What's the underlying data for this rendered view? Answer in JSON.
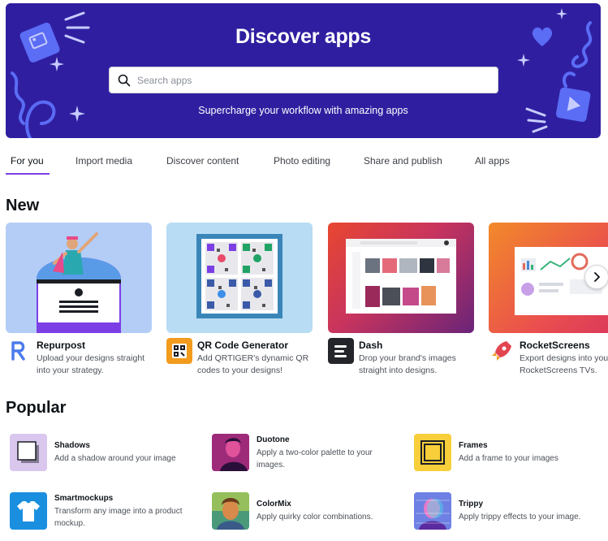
{
  "hero": {
    "title": "Discover apps",
    "search_placeholder": "Search apps",
    "subtitle": "Supercharge your workflow with amazing apps",
    "bg_color": "#2f1fa0",
    "accent": "#5b6cf5"
  },
  "tabs": [
    {
      "label": "For you",
      "active": true
    },
    {
      "label": "Import media"
    },
    {
      "label": "Discover content"
    },
    {
      "label": "Photo editing"
    },
    {
      "label": "Share and publish"
    },
    {
      "label": "All apps"
    }
  ],
  "new_section": {
    "title": "New",
    "apps": [
      {
        "name": "Repurpost",
        "description": "Upload your designs straight into your strategy.",
        "icon": "repurpost-logo"
      },
      {
        "name": "QR Code Generator",
        "description": "Add QRTIGER's dynamic QR codes to your designs!",
        "icon": "qrtiger-logo"
      },
      {
        "name": "Dash",
        "description": "Drop your brand's images straight into designs.",
        "icon": "dash-logo"
      },
      {
        "name": "RocketScreens",
        "description": "Export designs into your RocketScreens TVs.",
        "icon": "rocket-logo"
      }
    ]
  },
  "popular_section": {
    "title": "Popular",
    "apps": [
      {
        "name": "Shadows",
        "description": "Add a shadow around your image",
        "icon": "shadows-icon"
      },
      {
        "name": "Duotone",
        "description": "Apply a two-color palette to your images.",
        "icon": "duotone-thumbnail"
      },
      {
        "name": "Frames",
        "description": "Add a frame to your images",
        "icon": "frames-icon"
      },
      {
        "name": "Smartmockups",
        "description": "Transform any image into a product mockup.",
        "icon": "tshirt-icon"
      },
      {
        "name": "ColorMix",
        "description": "Apply quirky color combinations.",
        "icon": "colormix-thumbnail"
      },
      {
        "name": "Trippy",
        "description": "Apply trippy effects to your image.",
        "icon": "trippy-thumbnail"
      }
    ]
  }
}
